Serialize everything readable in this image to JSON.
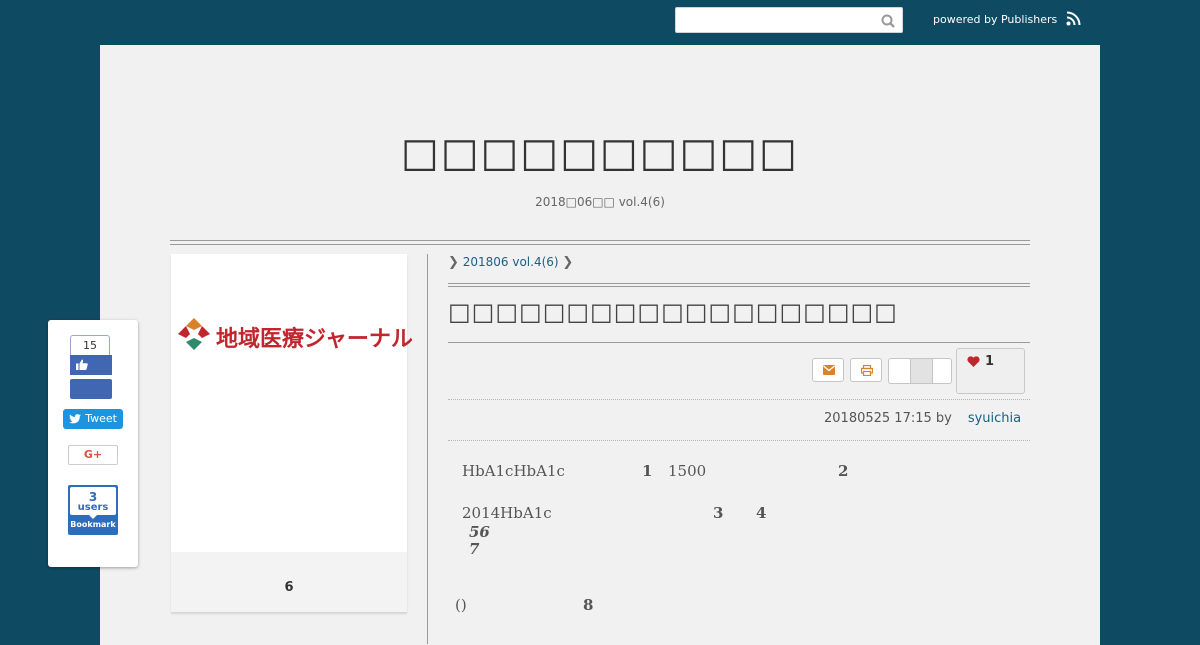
{
  "topbar": {
    "search_placeholder": "",
    "powered_by": "powered by Publishers"
  },
  "site": {
    "title": "□□□□□□□□□□",
    "subtitle": "2018□06□□ vol.4(6)"
  },
  "sidebar_card": {
    "logo_text": "地域医療ジャーナル",
    "count": "6"
  },
  "breadcrumb": {
    "item": "201806 vol.4(6)"
  },
  "article": {
    "title": "□□□□□□□□□□□□□□□□□□□",
    "like_count": "1",
    "date": "20180525 17:15 by",
    "author": "syuichia",
    "p1": {
      "text_a": "HbA1cHbA1c",
      "num_1": "1",
      "text_b": "1500",
      "num_2": "2"
    },
    "p2": {
      "text_a": "2014HbA1c",
      "num_3": "3",
      "num_4": "4",
      "num_56": "56",
      "num_7": "7"
    },
    "p3": {
      "text_a": "()",
      "num_8": "8"
    }
  },
  "social": {
    "fb_count": "15",
    "tweet_label": "Tweet",
    "gplus_label": "G+",
    "hatena_count": "3",
    "hatena_users": "users",
    "hatena_label": "Bookmark"
  },
  "colors": {
    "background": "#0e4a62",
    "link": "#1d5e83",
    "accent_orange": "#d9822b",
    "logo_red": "#c0262c",
    "facebook": "#4267b2",
    "twitter": "#1b95e0",
    "hatena": "#2c6ebd"
  }
}
